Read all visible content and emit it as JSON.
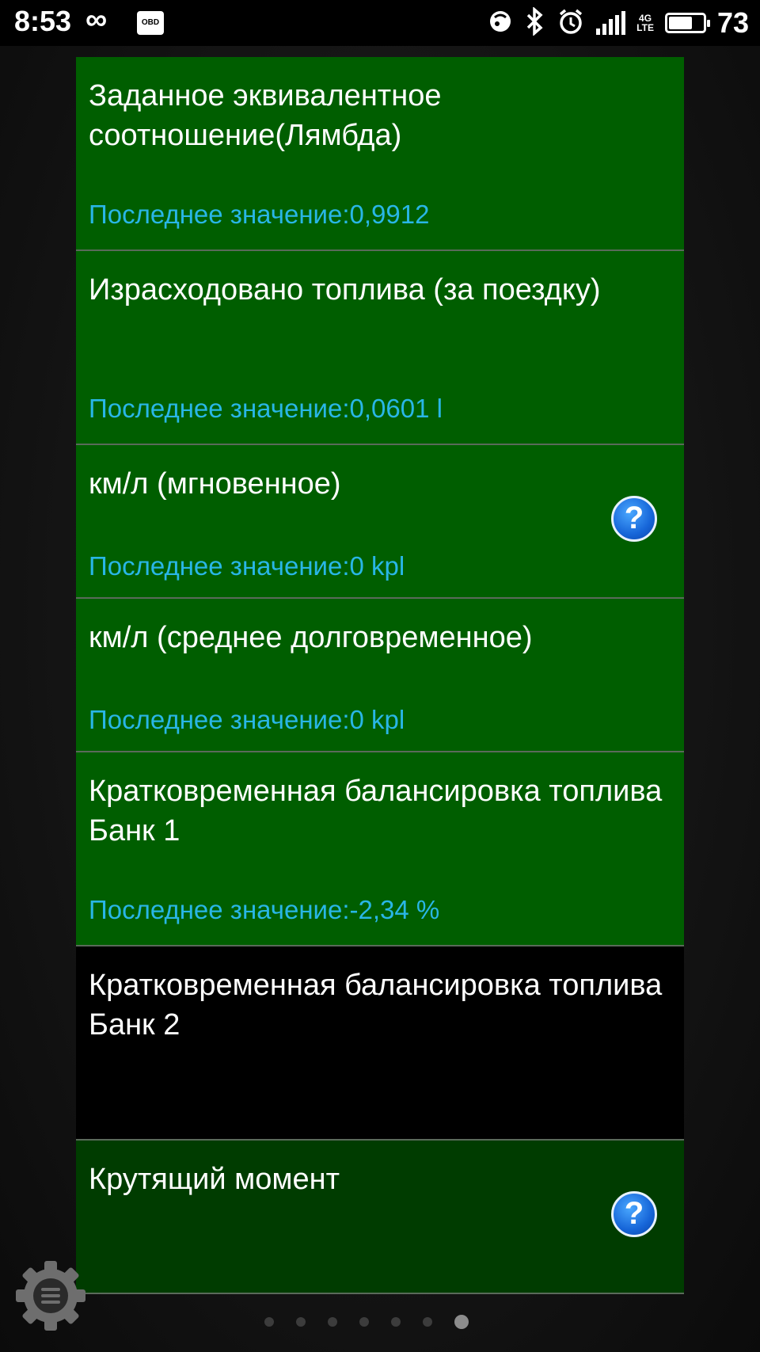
{
  "status_bar": {
    "time": "8:53",
    "loop_icon": "infinity-icon",
    "obd_badge": "OBD",
    "battery_percent": "73",
    "battery_level": 0.73
  },
  "list": {
    "items": [
      {
        "title": "Заданное эквивалентное соотношение(Лямбда)",
        "value": "Последнее значение:0,9912",
        "help": false
      },
      {
        "title": "Израсходовано топлива (за поездку)",
        "value": "Последнее значение:0,0601 l",
        "help": false
      },
      {
        "title": "км/л (мгновенное)",
        "value": "Последнее значение:0 kpl",
        "help": true
      },
      {
        "title": "км/л (среднее долговременное)",
        "value": "Последнее значение:0 kpl",
        "help": false
      },
      {
        "title": "Кратковременная балансировка топлива Банк 1",
        "value": "Последнее значение:-2,34 %",
        "help": false
      },
      {
        "title": "Кратковременная балансировка топлива Банк 2",
        "value": "",
        "help": false
      },
      {
        "title": "Крутящий момент",
        "value": "",
        "help": true
      }
    ],
    "help_glyph": "?"
  },
  "pager": {
    "total": 7,
    "active": 7
  },
  "colors": {
    "item_selected": "#005e00",
    "item_unselected": "#000000",
    "item_dim": "#003c00",
    "value_text": "#29b6e6"
  }
}
